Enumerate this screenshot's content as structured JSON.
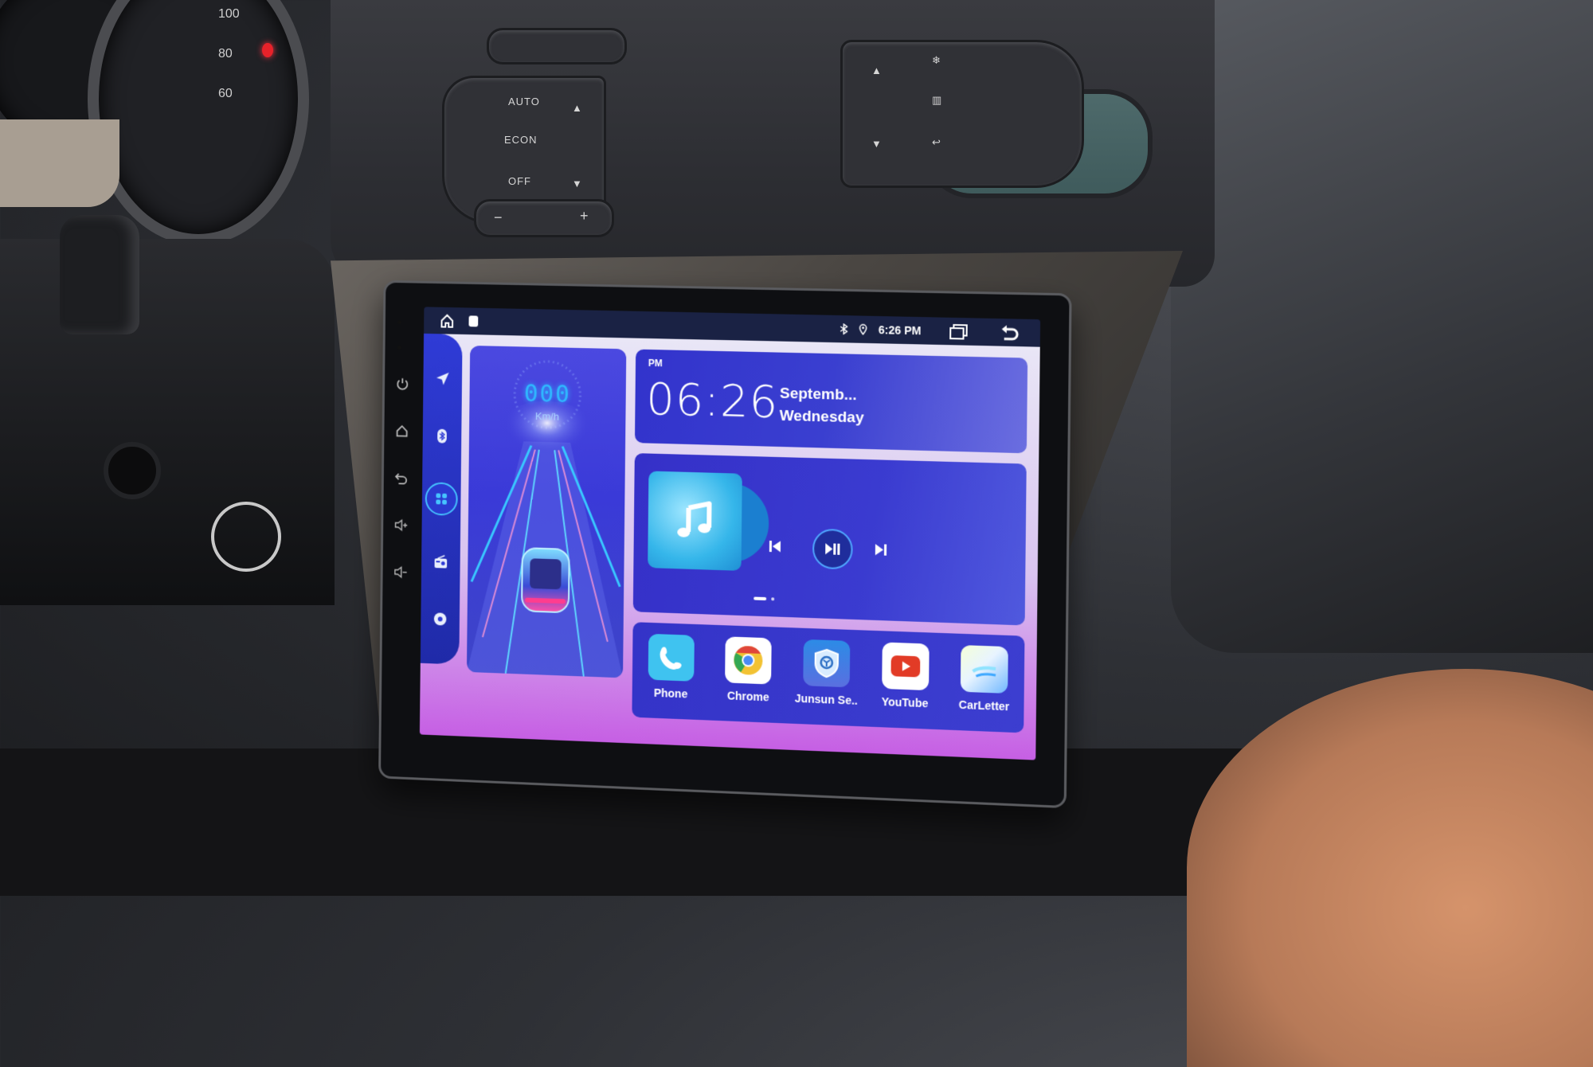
{
  "climate": {
    "display": "OFF",
    "left_buttons": [
      "AUTO",
      "ECON",
      "OFF"
    ],
    "fan_minus": "−",
    "fan_plus": "+"
  },
  "cluster": {
    "ticks": [
      "100",
      "80",
      "60"
    ]
  },
  "status_bar": {
    "time": "6:26 PM",
    "icons": [
      "home-icon",
      "app-indicator-icon",
      "bluetooth-icon",
      "location-icon",
      "recent-apps-icon",
      "back-icon"
    ]
  },
  "dock": {
    "items": [
      {
        "name": "navigation",
        "icon": "navigation-icon"
      },
      {
        "name": "bluetooth",
        "icon": "bluetooth-icon"
      },
      {
        "name": "apps",
        "icon": "apps-grid-icon",
        "active": true
      },
      {
        "name": "radio",
        "icon": "radio-icon"
      },
      {
        "name": "settings",
        "icon": "settings-icon"
      }
    ]
  },
  "hardware_buttons": [
    "power",
    "home",
    "back",
    "volume-up",
    "volume-down"
  ],
  "speed_widget": {
    "value": "000",
    "unit": "Km/h"
  },
  "clock_widget": {
    "ampm": "PM",
    "time": "06:26",
    "month": "Septemb...",
    "weekday": "Wednesday"
  },
  "music_widget": {
    "controls": [
      "previous",
      "play-pause",
      "next"
    ],
    "page_count": 2,
    "current_page": 1
  },
  "apps": [
    {
      "label": "Phone",
      "icon": "phone-icon",
      "color": "#3fc3f0"
    },
    {
      "label": "Chrome",
      "icon": "chrome-icon",
      "color": "#ffffff"
    },
    {
      "label": "Junsun Se..",
      "icon": "junsun-shield-icon",
      "color": "#2c8be6"
    },
    {
      "label": "YouTube",
      "icon": "youtube-icon",
      "color": "#ffffff"
    },
    {
      "label": "CarLetter",
      "icon": "carletter-icon",
      "color": "#e8f4ff"
    }
  ],
  "colors": {
    "dock": "#2f3bd6",
    "accent": "#2fb7ff",
    "card": "#3a3bd0",
    "wallpaper_bottom": "#c65fe4"
  }
}
